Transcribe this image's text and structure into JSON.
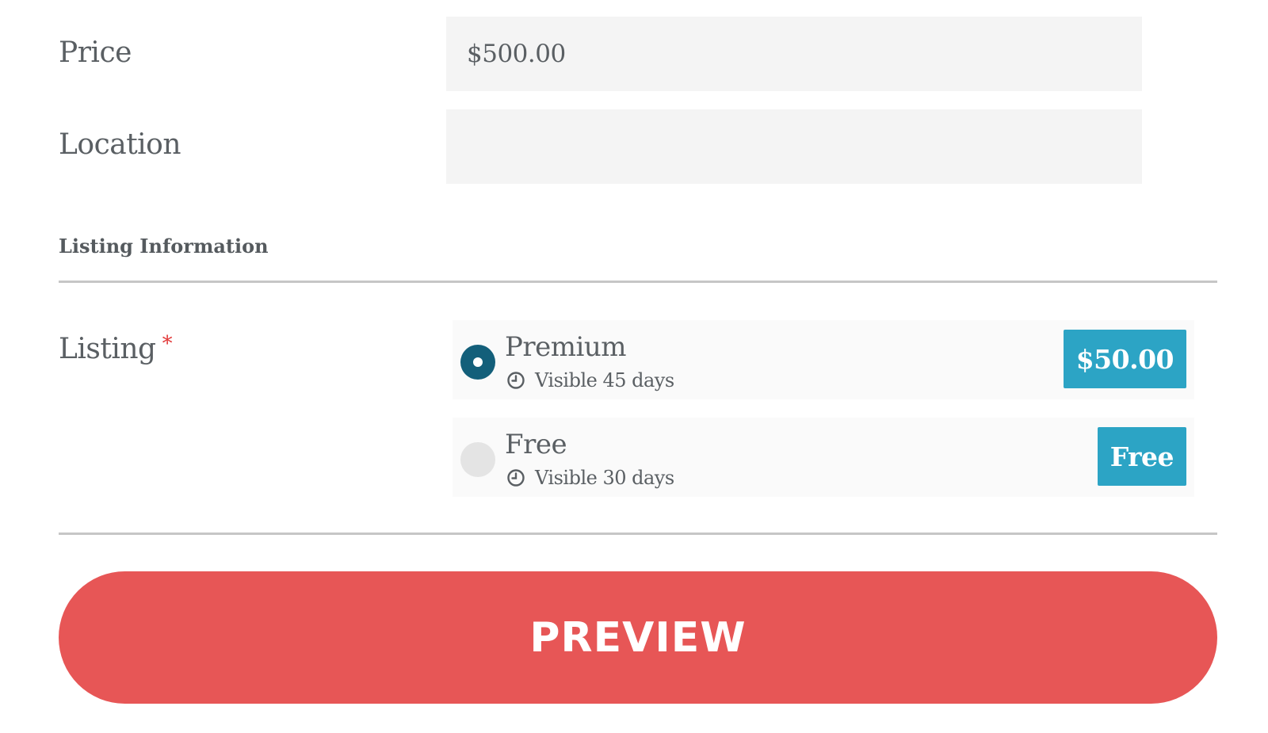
{
  "form": {
    "price": {
      "label": "Price",
      "value": "$500.00"
    },
    "location": {
      "label": "Location",
      "value": "",
      "placeholder": ""
    },
    "section_title": "Listing Information",
    "listing": {
      "label": "Listing",
      "required_mark": "*",
      "options": [
        {
          "name": "Premium",
          "visibility": "Visible 45 days",
          "price": "$50.00",
          "selected": true
        },
        {
          "name": "Free",
          "visibility": "Visible 30 days",
          "price": "Free",
          "selected": false
        }
      ]
    },
    "preview_label": "PREVIEW"
  },
  "icons": {
    "visibility": "clock-icon"
  },
  "colors": {
    "accent_badge": "#2ca4c5",
    "radio_selected": "#135f7a",
    "preview_button": "#e75656",
    "required": "#e23b3b"
  }
}
